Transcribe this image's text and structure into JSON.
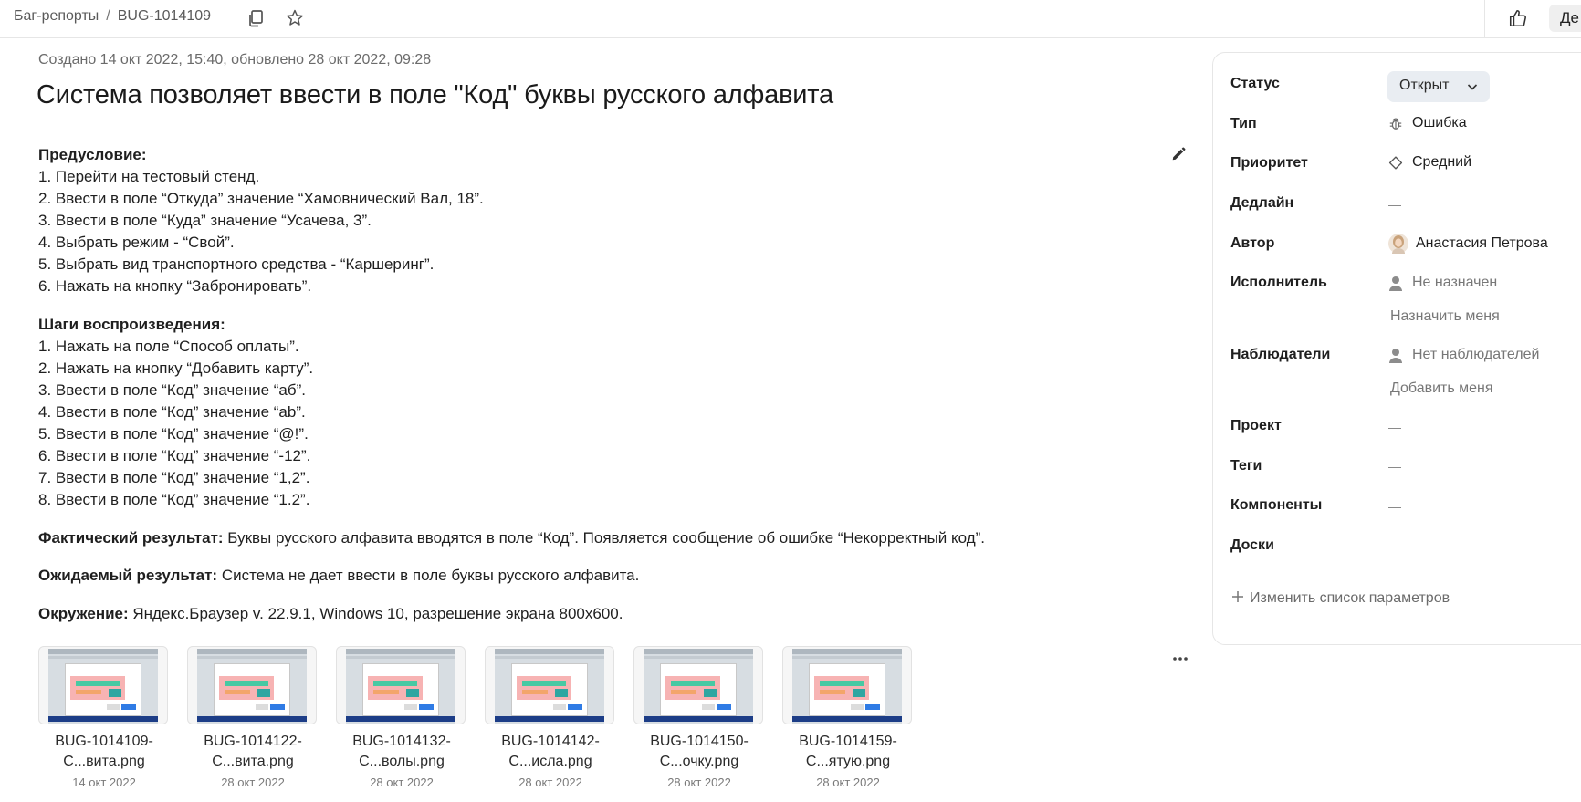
{
  "header": {
    "breadcrumb_root": "Баг-репорты",
    "breadcrumb_separator": "/",
    "issue_key": "BUG-1014109",
    "copy_icon": "copy-icon",
    "star_icon": "star-icon",
    "like_icon": "thumbs-up-icon",
    "cut_button_label": "Де"
  },
  "issue": {
    "meta": "Создано 14 окт 2022, 15:40, обновлено 28 окт 2022, 09:28",
    "title": "Система позволяет ввести в поле \"Код\" буквы русского алфавита",
    "precondition_heading": "Предусловие:",
    "preconditions": [
      "1. Перейти на тестовый стенд.",
      "2. Ввести в поле “Откуда” значение “Хамовнический Вал, 18”.",
      "3. Ввести в поле “Куда” значение “Усачева, 3”.",
      "4. Выбрать режим - “Свой”.",
      "5. Выбрать вид транспортного средства - “Каршеринг”.",
      "6. Нажать на кнопку “Забронировать”."
    ],
    "steps_heading": "Шаги воспроизведения:",
    "steps": [
      "1. Нажать на поле “Способ оплаты”.",
      "2. Нажать на кнопку “Добавить карту”.",
      "3. Ввести в поле “Код” значение “аб”.",
      "4. Ввести в поле “Код” значение “ab”.",
      "5. Ввести в поле “Код” значение “@!”.",
      "6. Ввести в поле “Код” значение “-12”.",
      "7. Ввести в поле “Код” значение “1,2”.",
      "8. Ввести в поле “Код” значение “1.2”."
    ],
    "actual_label": "Фактический результат:",
    "actual_text": " Буквы русского алфавита вводятся в поле “Код”. Появляется сообщение об ошибке “Некорректный код”.",
    "expected_label": "Ожидаемый результат:",
    "expected_text": " Система не дает ввести в поле буквы русского алфавита.",
    "env_label": "Окружение:",
    "env_text": " Яндекс.Браузер v. 22.9.1, Windows 10, разрешение экрана 800x600."
  },
  "attachments": [
    {
      "name_line1": "BUG-1014109-",
      "name_line2": "С...вита.png",
      "date": "14 окт 2022"
    },
    {
      "name_line1": "BUG-1014122-",
      "name_line2": "С...вита.png",
      "date": "28 окт 2022"
    },
    {
      "name_line1": "BUG-1014132-",
      "name_line2": "С...волы.png",
      "date": "28 окт 2022"
    },
    {
      "name_line1": "BUG-1014142-",
      "name_line2": "С...исла.png",
      "date": "28 окт 2022"
    },
    {
      "name_line1": "BUG-1014150-",
      "name_line2": "С...очку.png",
      "date": "28 окт 2022"
    },
    {
      "name_line1": "BUG-1014159-",
      "name_line2": "С...ятую.png",
      "date": "28 окт 2022"
    }
  ],
  "sidebar": {
    "status_label": "Статус",
    "status_value": "Открыт",
    "type_label": "Тип",
    "type_value": "Ошибка",
    "type_icon": "bug-icon",
    "priority_label": "Приоритет",
    "priority_value": "Средний",
    "priority_icon": "diamond-icon",
    "deadline_label": "Дедлайн",
    "author_label": "Автор",
    "author_value": "Анастасия Петрова",
    "assignee_label": "Исполнитель",
    "assignee_value": "Не назначен",
    "assign_me": "Назначить меня",
    "watchers_label": "Наблюдатели",
    "watchers_value": "Нет наблюдателей",
    "add_me": "Добавить меня",
    "project_label": "Проект",
    "tags_label": "Теги",
    "components_label": "Компоненты",
    "boards_label": "Доски",
    "edit_params": "Изменить список параметров"
  },
  "colors": {
    "status_bg": "#e9edf2",
    "border": "#e6e6e6",
    "muted_text": "#777777"
  }
}
